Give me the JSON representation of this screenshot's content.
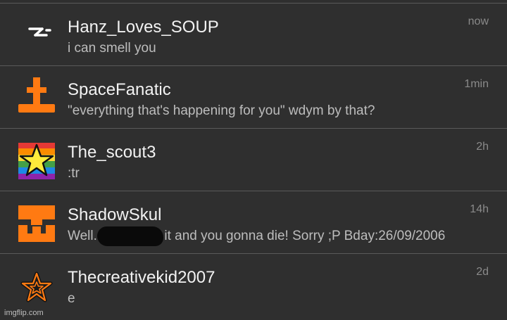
{
  "conversations": [
    {
      "name": "Hanz_Loves_SOUP",
      "preview": "i can smell you",
      "time": "now",
      "avatar_icon": "lightning-icon"
    },
    {
      "name": "SpaceFanatic",
      "preview": "\"everything that's happening for you\" wdym by that?",
      "time": "1min",
      "avatar_icon": "orange-cross-icon"
    },
    {
      "name": "The_scout3",
      "preview": ":tr",
      "time": "2h",
      "avatar_icon": "rainbow-star-icon"
    },
    {
      "name": "ShadowSkul",
      "preview": "Well.. I can't tell it and you gonna die! Sorry ;P Bday:26/09/2006",
      "time": "14h",
      "avatar_icon": "orange-skull-icon"
    },
    {
      "name": "Thecreativekid2007",
      "preview": "e",
      "time": "2d",
      "avatar_icon": "star-outline-icon"
    }
  ],
  "watermark": "imgflip.com",
  "colors": {
    "background": "#2f2f2f",
    "accent_orange": "#ff7a12",
    "divider": "#5a5a5a"
  }
}
